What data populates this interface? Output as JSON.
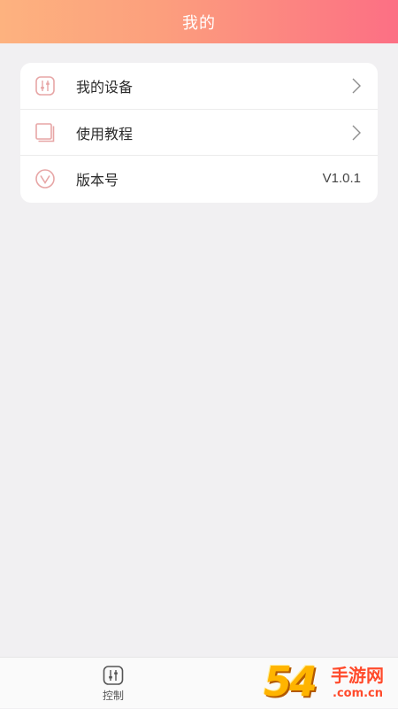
{
  "header": {
    "title": "我的"
  },
  "menu": {
    "items": [
      {
        "label": "我的设备",
        "icon": "device-sliders-icon",
        "trailing": "chevron"
      },
      {
        "label": "使用教程",
        "icon": "tutorial-book-icon",
        "trailing": "chevron"
      },
      {
        "label": "版本号",
        "icon": "version-v-icon",
        "value": "V1.0.1"
      }
    ]
  },
  "tabbar": {
    "tabs": [
      {
        "label": "控制",
        "icon": "control-sliders-icon"
      }
    ]
  },
  "watermark": {
    "number": "54",
    "text": "手游网",
    "domain": ".com.cn"
  },
  "colors": {
    "header_gradient_start": "#fdb27f",
    "header_gradient_end": "#fc6f84",
    "icon_accent": "#e7a6a6",
    "background": "#f1f0f2"
  }
}
